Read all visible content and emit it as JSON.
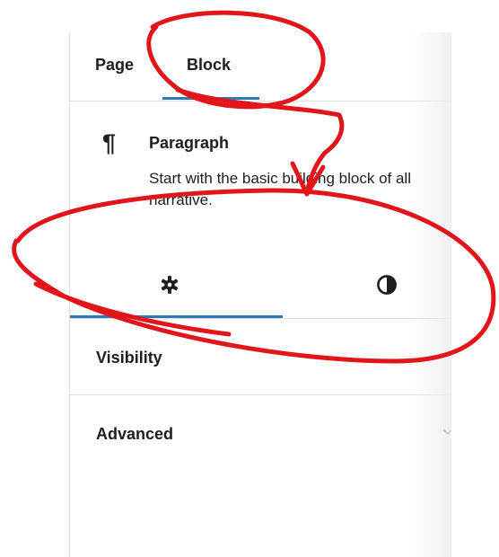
{
  "sidebar": {
    "tabs": [
      {
        "label": "Page",
        "active": false
      },
      {
        "label": "Block",
        "active": true
      }
    ],
    "block": {
      "icon": "paragraph-icon",
      "icon_glyph": "¶",
      "title": "Paragraph",
      "description": "Start with the basic building block of all narrative."
    },
    "inspector_tabs": [
      {
        "icon": "gear-icon",
        "active": true
      },
      {
        "icon": "contrast-icon",
        "active": false
      }
    ],
    "sections": [
      {
        "label": "Visibility"
      },
      {
        "label": "Advanced"
      }
    ]
  },
  "colors": {
    "accent": "#2b7bb9",
    "annotation": "#e0161b",
    "divider": "#e0e0e0",
    "text": "#1e1e1e"
  }
}
